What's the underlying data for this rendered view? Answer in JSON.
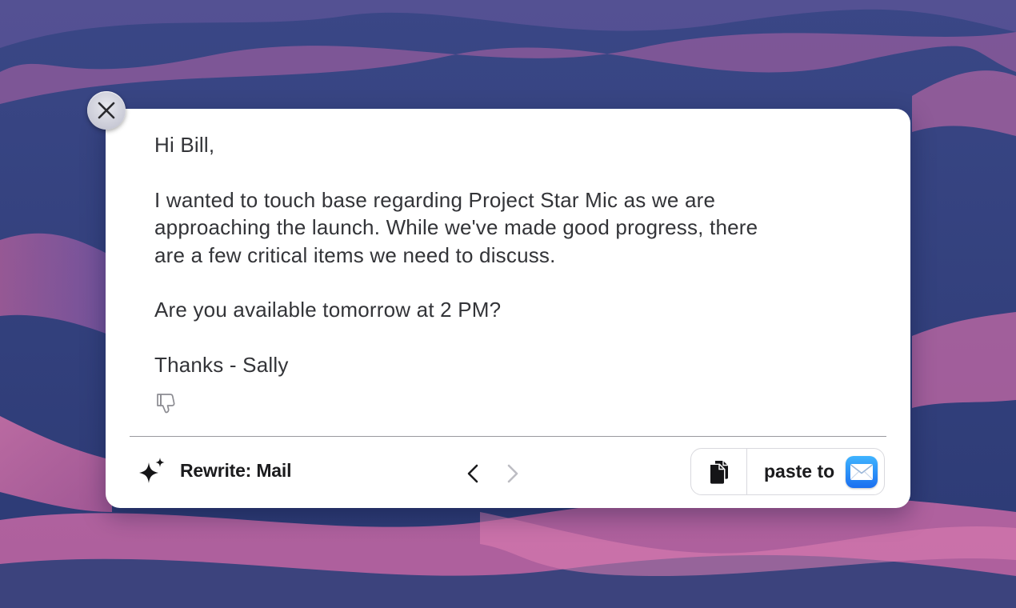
{
  "colors": {
    "panel_background": "#ffffff",
    "text": "#333438",
    "label_text": "#1b1b1d",
    "mail_icon_top": "#3fb4ff",
    "mail_icon_bottom": "#1a6ff0"
  },
  "close": {
    "icon": "close-icon"
  },
  "message": {
    "greeting": "Hi Bill,",
    "body_line_1": "I wanted to touch base regarding Project Star Mic as we are",
    "body_line_2": "approaching the launch. While we've made good progress, there",
    "body_line_3": "are a few critical items we need to discuss.",
    "question": "Are you available tomorrow at 2 PM?",
    "signoff": "Thanks - Sally"
  },
  "feedback": {
    "icon": "thumbs-down-icon"
  },
  "footer": {
    "mode_icon": "sparkle-icon",
    "mode_label": "Rewrite: Mail",
    "prev_icon": "chevron-left-icon",
    "next_icon": "chevron-right-icon",
    "copy_icon": "copy-icon",
    "paste_label": "paste to",
    "paste_target_icon": "mail-app-icon"
  }
}
